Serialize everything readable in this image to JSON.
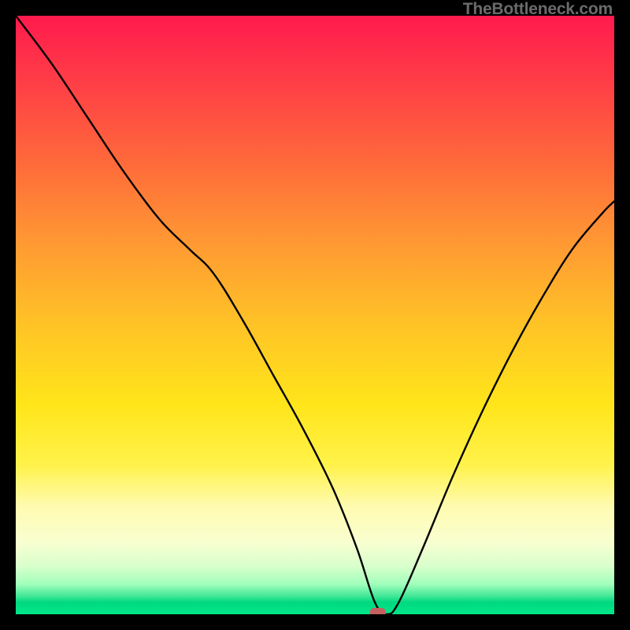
{
  "watermark": "TheBottleneck.com",
  "chart_data": {
    "type": "line",
    "title": "",
    "xlabel": "",
    "ylabel": "",
    "xlim": [
      0,
      100
    ],
    "ylim": [
      0,
      100
    ],
    "grid": false,
    "marker": {
      "x": 60.5,
      "y": 0,
      "color": "#c66060"
    },
    "series": [
      {
        "name": "bottleneck-curve",
        "color": "#000000",
        "x": [
          0,
          6,
          12,
          18,
          24,
          29,
          33,
          38,
          43,
          48,
          53,
          57,
          60,
          62,
          64,
          68,
          73,
          78,
          83,
          88,
          93,
          98,
          100
        ],
        "values": [
          100,
          92,
          83,
          74,
          66,
          61,
          57,
          49,
          40,
          31,
          21,
          11,
          2,
          0,
          2,
          11,
          23,
          34,
          44,
          53,
          61,
          67,
          69
        ]
      }
    ]
  }
}
